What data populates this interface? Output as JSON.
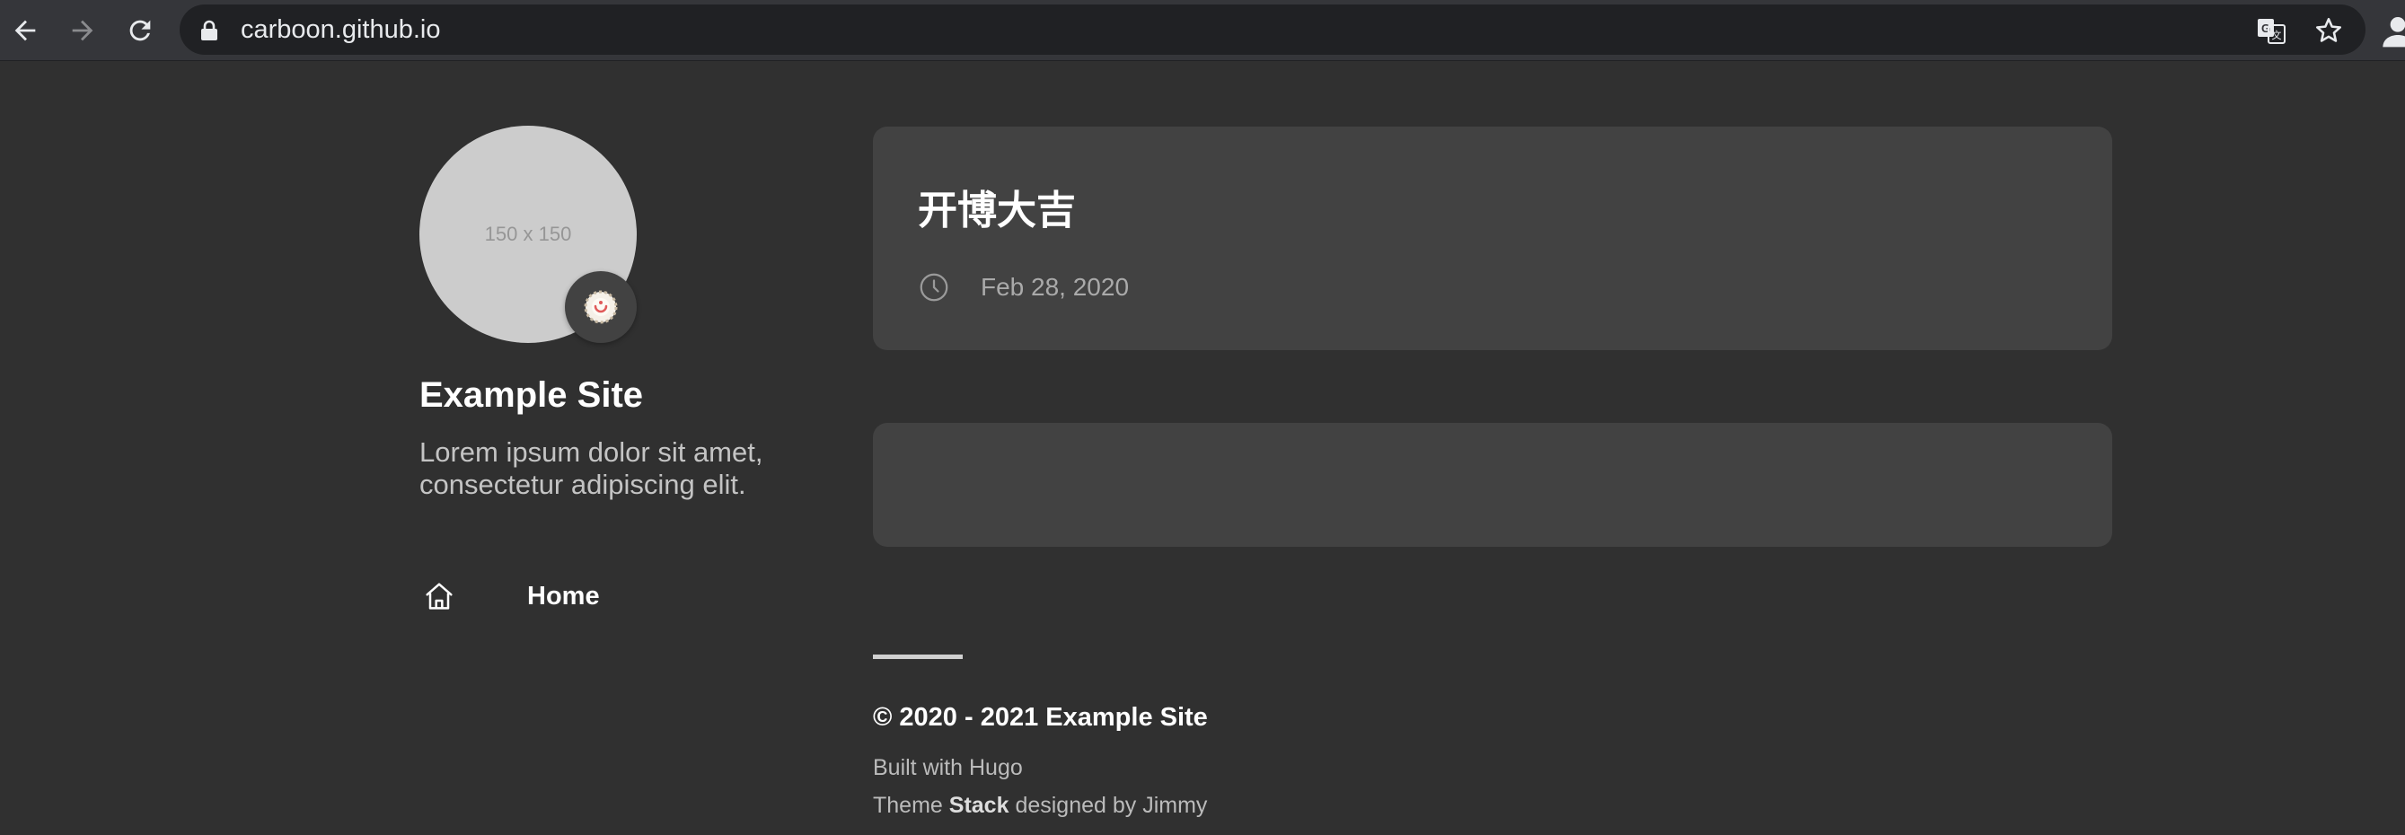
{
  "browser": {
    "url": "carboon.github.io",
    "icons": [
      "back-icon",
      "forward-icon",
      "reload-icon",
      "lock-icon",
      "translate-icon",
      "star-icon",
      "profile-icon"
    ]
  },
  "sidebar": {
    "avatar_placeholder": "150 x 150",
    "site_name": "Example Site",
    "description": "Lorem ipsum dolor sit amet, consectetur adipiscing elit.",
    "menu": [
      {
        "label": "Home",
        "icon": "home-icon"
      }
    ]
  },
  "main": {
    "posts": [
      {
        "title": "开博大吉",
        "date": "Feb 28, 2020"
      }
    ]
  },
  "footer": {
    "copyright": "© 2020 - 2021 Example Site",
    "built_with": "Built with Hugo",
    "theme_prefix": "Theme",
    "theme_name": "Stack",
    "theme_suffix": "designed by Jimmy"
  },
  "colors": {
    "background": "#303030",
    "card": "#424242",
    "text": "#ffffff",
    "muted": "#aaaaaa"
  }
}
